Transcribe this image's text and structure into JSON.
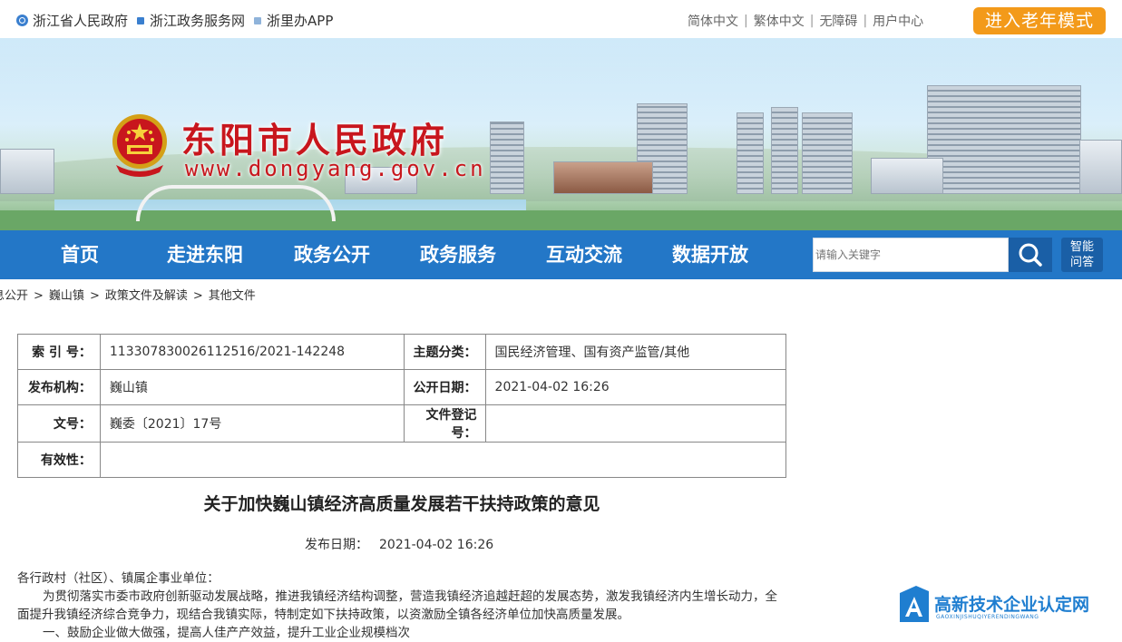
{
  "topbar": {
    "links": [
      {
        "label": "浙江省人民政府",
        "icon": "globe-icon"
      },
      {
        "label": "浙江政务服务网",
        "icon": "square-icon"
      },
      {
        "label": "浙里办APP",
        "icon": "square-icon"
      }
    ],
    "right_links": [
      "简体中文",
      "繁体中文",
      "无障碍",
      "用户中心"
    ],
    "elder_mode": "进入老年模式",
    "accent": "#f39a1a"
  },
  "banner": {
    "site_title": "东阳市人民政府",
    "site_url": "www.dongyang.gov.cn",
    "title_color": "#c8161d"
  },
  "nav": {
    "items": [
      "首页",
      "走进东阳",
      "政务公开",
      "政务服务",
      "互动交流",
      "数据开放"
    ],
    "search_placeholder": "请输入关键字",
    "ai_label": [
      "智能",
      "问答"
    ],
    "bg": "#2377c7"
  },
  "breadcrumb": [
    "息公开",
    "巍山镇",
    "政策文件及解读",
    "其他文件"
  ],
  "info": {
    "rows": [
      [
        {
          "label": "索 引 号：",
          "value": "113307830026112516/2021-142248"
        },
        {
          "label": "主题分类：",
          "value": "国民经济管理、国有资产监管/其他"
        }
      ],
      [
        {
          "label": "发布机构：",
          "value": "巍山镇"
        },
        {
          "label": "公开日期：",
          "value": "2021-04-02 16:26"
        }
      ],
      [
        {
          "label": "文号：",
          "value": "巍委〔2021〕17号"
        },
        {
          "label": "文件登记号：",
          "value": ""
        }
      ],
      [
        {
          "label": "有效性：",
          "value": ""
        }
      ]
    ]
  },
  "document": {
    "title": "关于加快巍山镇经济高质量发展若干扶持政策的意见",
    "pub_label": "发布日期：",
    "pub_date": "2021-04-02 16:26",
    "salutation": "各行政村（社区）、镇属企事业单位：",
    "para1": "为贯彻落实市委市政府创新驱动发展战略，推进我镇经济结构调整，营造我镇经济追越赶超的发展态势，激发我镇经济内生增长动力，全面提升我镇经济综合竞争力，现结合我镇实际，特制定如下扶持政策，以资激励全镇各经济单位加快高质量发展。",
    "para2": "一、鼓励企业做大做强，提高人佳产产效益，提升工业企业规模档次"
  },
  "watermark": {
    "text": "高新技术企业认定网",
    "sub": "GAOXINJISHUQIYERENDINGWANG"
  }
}
